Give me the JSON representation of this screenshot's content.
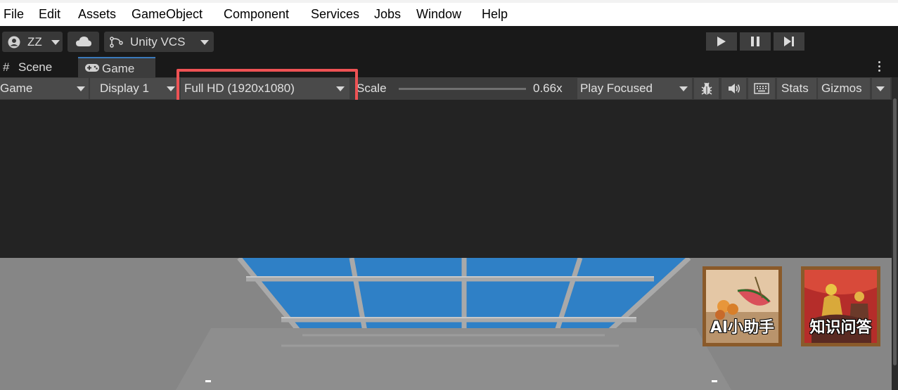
{
  "menubar": {
    "items": [
      "File",
      "Edit",
      "Assets",
      "GameObject",
      "Component",
      "Services",
      "Jobs",
      "Window",
      "Help"
    ]
  },
  "toolbar": {
    "account_label": "ZZ",
    "vcs_label": "Unity VCS"
  },
  "tabs": [
    {
      "label": "Scene",
      "icon": "grid-icon",
      "active": false
    },
    {
      "label": "Game",
      "icon": "gamepad-icon",
      "active": true
    }
  ],
  "game_toolbar": {
    "view_mode": "Game",
    "display": "Display 1",
    "resolution": "Full HD (1920x1080)",
    "scale_label": "Scale",
    "scale_value": "0.66x",
    "play_mode": "Play Focused",
    "stats_label": "Stats",
    "gizmos_label": "Gizmos"
  },
  "game_view": {
    "buttons": [
      {
        "label": "AI小助手"
      },
      {
        "label": "知识问答"
      }
    ]
  },
  "colors": {
    "highlight": "#ee5254",
    "active_tab_accent": "#3a79bb",
    "window_glass": "#2f80c6",
    "frame_gold": "#8a5a2a"
  }
}
